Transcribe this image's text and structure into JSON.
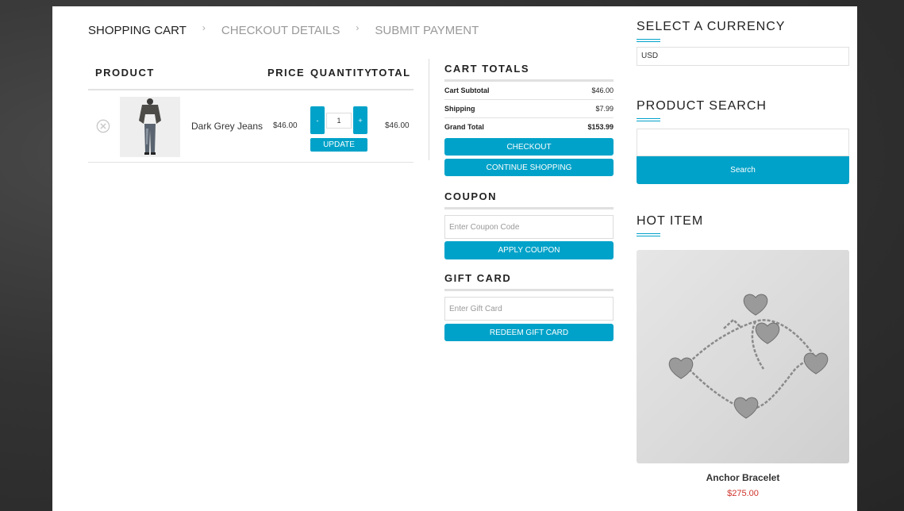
{
  "breadcrumb": {
    "step1": "SHOPPING CART",
    "step2": "CHECKOUT DETAILS",
    "step3": "SUBMIT PAYMENT",
    "separator": "›"
  },
  "cart": {
    "headers": {
      "product": "PRODUCT",
      "price": "PRICE",
      "quantity": "QUANTITY",
      "total": "TOTAL"
    },
    "item": {
      "name": "Dark Grey Jeans",
      "price": "$46.00",
      "quantity": "1",
      "total": "$46.00",
      "minus": "-",
      "plus": "+",
      "update": "UPDATE"
    }
  },
  "totals": {
    "title": "CART TOTALS",
    "subtotal_label": "Cart Subtotal",
    "subtotal_value": "$46.00",
    "shipping_label": "Shipping",
    "shipping_value": "$7.99",
    "grand_label": "Grand Total",
    "grand_value": "$153.99",
    "checkout": "CHECKOUT",
    "continue": "CONTINUE SHOPPING"
  },
  "coupon": {
    "title": "COUPON",
    "placeholder": "Enter Coupon Code",
    "button": "APPLY COUPON"
  },
  "gift": {
    "title": "GIFT CARD",
    "placeholder": "Enter Gift Card",
    "button": "REDEEM GIFT CARD"
  },
  "sidebar": {
    "currency_title": "SELECT A CURRENCY",
    "currency_value": "USD",
    "search_title": "PRODUCT SEARCH",
    "search_button": "Search",
    "hot_title": "HOT ITEM",
    "hot_name": "Anchor Bracelet",
    "hot_price": "$275.00"
  },
  "colors": {
    "accent": "#00a2c9",
    "price_red": "#d0342c"
  }
}
